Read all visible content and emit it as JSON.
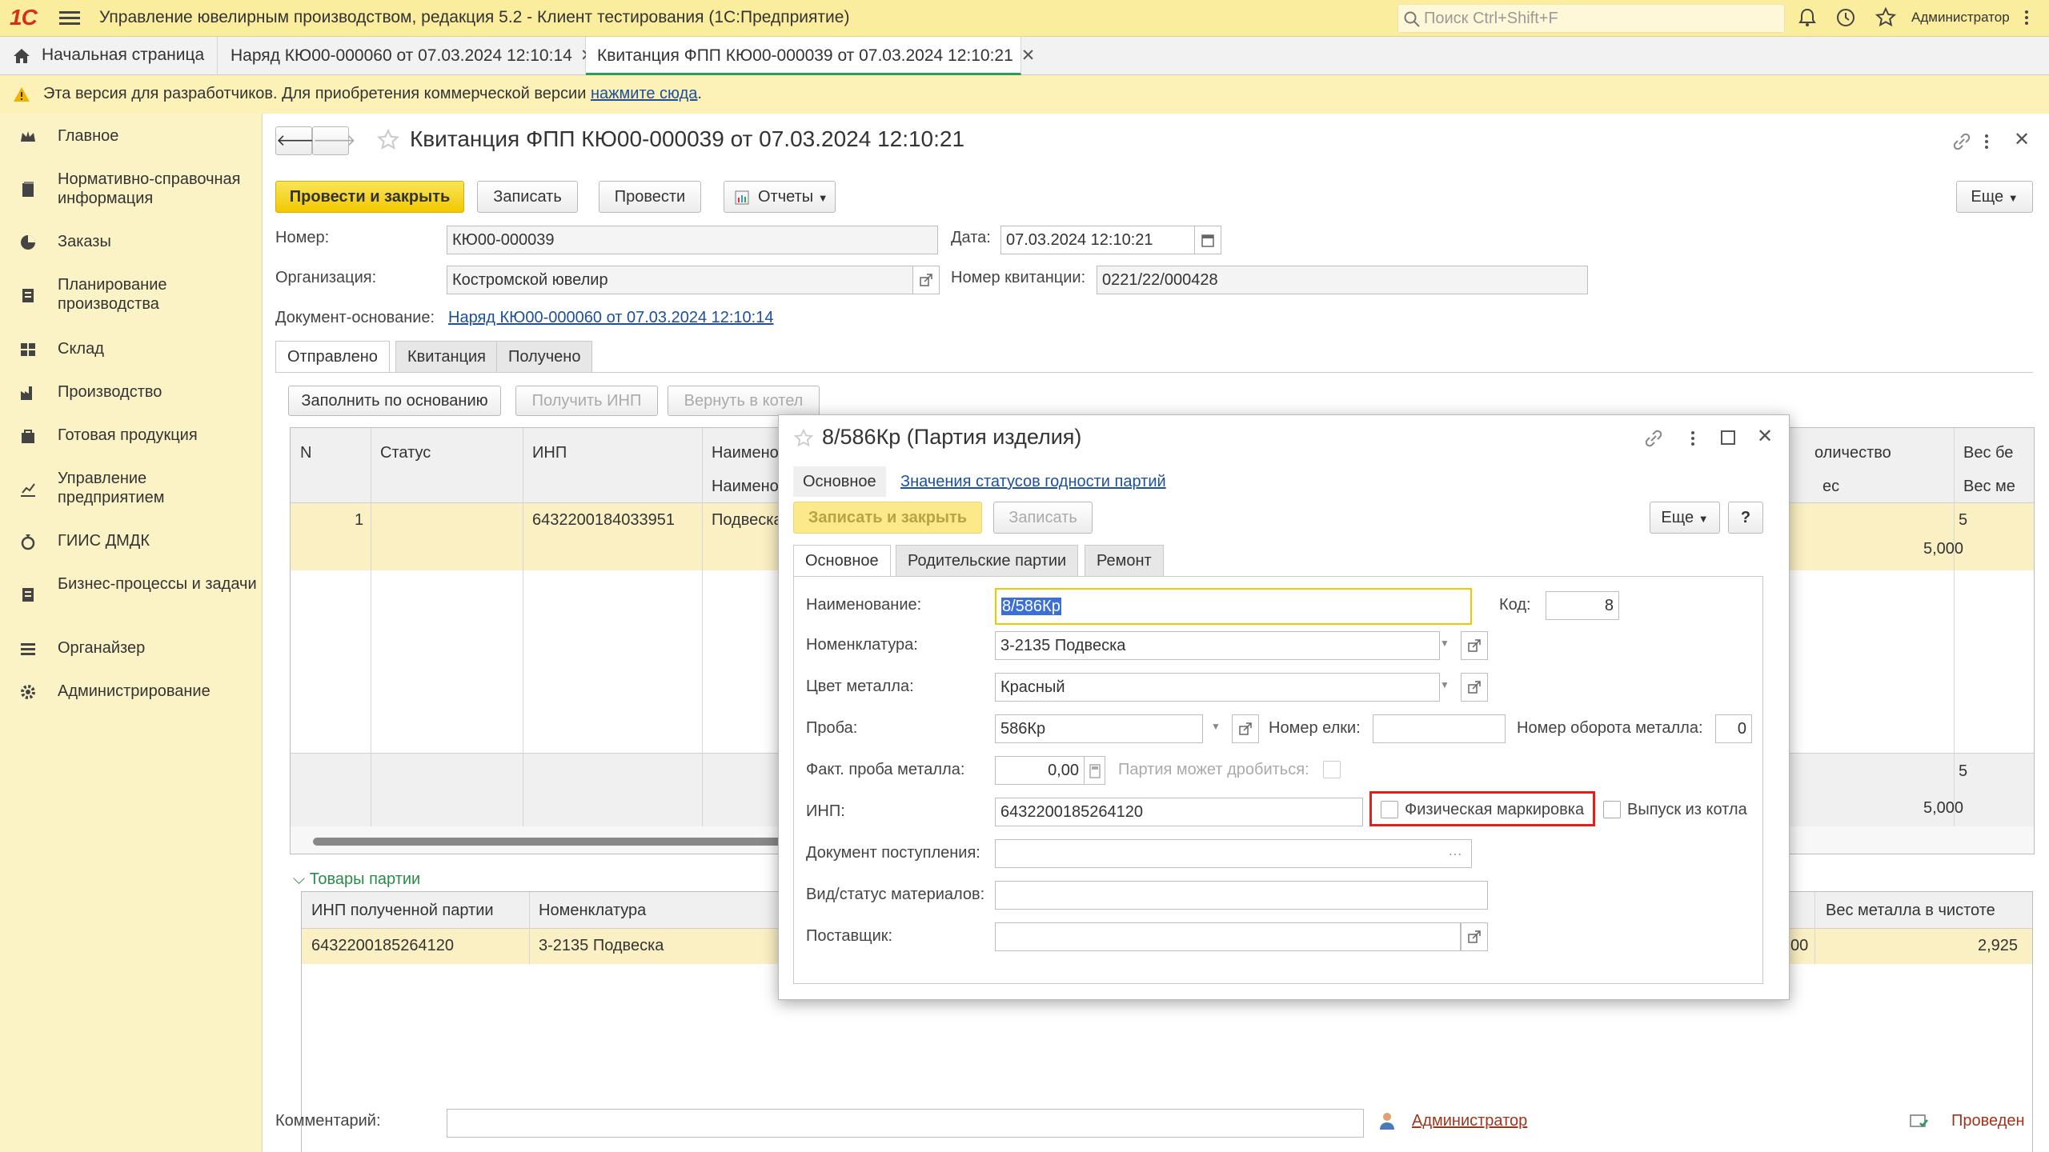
{
  "app": {
    "logo": "1С",
    "title": "Управление ювелирным производством, редакция 5.2  - Клиент тестирования (1С:Предприятие)",
    "search_placeholder": "Поиск Ctrl+Shift+F",
    "user": "Администратор"
  },
  "tabs": [
    {
      "label": "Начальная страница"
    },
    {
      "label": "Наряд КЮ00-000060 от 07.03.2024 12:10:14"
    },
    {
      "label": "Квитанция ФПП КЮ00-000039 от 07.03.2024 12:10:21"
    }
  ],
  "notice": {
    "text": "Эта версия для разработчиков. Для приобретения коммерческой версии ",
    "link": "нажмите сюда",
    "tail": "."
  },
  "sidebar": [
    {
      "label": "Главное",
      "icon": "crown-icon"
    },
    {
      "label": "Нормативно-справочная информация",
      "icon": "book-icon"
    },
    {
      "label": "Заказы",
      "icon": "pie-icon"
    },
    {
      "label": "Планирование производства",
      "icon": "clipboard-icon"
    },
    {
      "label": "Склад",
      "icon": "warehouse-icon"
    },
    {
      "label": "Производство",
      "icon": "factory-icon"
    },
    {
      "label": "Готовая продукция",
      "icon": "bag-icon"
    },
    {
      "label": "Управление предприятием",
      "icon": "chart-icon"
    },
    {
      "label": "ГИИС ДМДК",
      "icon": "ring-icon"
    },
    {
      "label": "Бизнес-процессы и задачи",
      "icon": "tasks-icon"
    },
    {
      "label": "Органайзер",
      "icon": "organizer-icon"
    },
    {
      "label": "Администрирование",
      "icon": "gear-icon"
    }
  ],
  "form": {
    "title": "Квитанция ФПП КЮ00-000039 от 07.03.2024 12:10:21",
    "btn_post_close": "Провести и закрыть",
    "btn_save": "Записать",
    "btn_post": "Провести",
    "btn_reports": "Отчеты",
    "btn_more": "Еще",
    "number_label": "Номер:",
    "number": "КЮ00-000039",
    "date_label": "Дата:",
    "date": "07.03.2024 12:10:21",
    "org_label": "Организация:",
    "org": "Костромской ювелир",
    "receipt_no_label": "Номер квитанции:",
    "receipt_no": "0221/22/000428",
    "base_doc_label": "Документ-основание:",
    "base_doc": "Наряд КЮ00-000060 от 07.03.2024 12:10:14",
    "tabs": [
      "Отправлено",
      "Квитанция",
      "Получено"
    ],
    "btn_fill": "Заполнить по основанию",
    "btn_get_inp": "Получить ИНП",
    "btn_return": "Вернуть в котел",
    "table": {
      "headers": [
        "N",
        "Статус",
        "ИНП",
        "Наимено",
        "Наимено"
      ],
      "right_headers": [
        "оличество",
        "Вес бе",
        "ес",
        "Вес ме"
      ],
      "rows": [
        {
          "n": "1",
          "status": "",
          "inp": "6432200184033951",
          "name": "Подвеска",
          "qty": "5",
          "qty2": "5,000"
        }
      ],
      "totals": [
        "5",
        "5,000"
      ]
    },
    "goods_section": "Товары партии",
    "goods": {
      "headers": [
        "ИНП полученной партии",
        "Номенклатура",
        "Вес металла в чистоте"
      ],
      "rows": [
        {
          "inp": "6432200185264120",
          "nom": "3-2135 Подвеска",
          "partial": "00",
          "weight": "2,925"
        }
      ]
    },
    "comment_label": "Комментарий:",
    "author": "Администратор",
    "status": "Проведен"
  },
  "dialog": {
    "title": "8/586Кр (Партия изделия)",
    "nav_main": "Основное",
    "nav_link": "Значения статусов годности партий",
    "btn_save_close": "Записать и закрыть",
    "btn_save": "Записать",
    "btn_more": "Еще",
    "btn_help": "?",
    "tabs": [
      "Основное",
      "Родительские партии",
      "Ремонт"
    ],
    "name_label": "Наименование:",
    "name": "8/586Кр",
    "code_label": "Код:",
    "code": "8",
    "nom_label": "Номенклатура:",
    "nom": "3-2135 Подвеска",
    "color_label": "Цвет металла:",
    "color": "Красный",
    "probe_label": "Проба:",
    "probe": "586Кр",
    "tree_label": "Номер елки:",
    "tree": "",
    "turn_label": "Номер оборота металла:",
    "turn": "0",
    "fact_label": "Факт. проба металла:",
    "fact": "0,00",
    "split_label": "Партия может дробиться:",
    "inp_label": "ИНП:",
    "inp": "6432200185264120",
    "phys_label": "Физическая маркировка",
    "release_label": "Выпуск из котла",
    "receipt_doc_label": "Документ поступления:",
    "material_label": "Вид/статус материалов:",
    "supplier_label": "Поставщик:"
  },
  "colors": {
    "accent_yellow": "#f1c800",
    "highlight_red": "#e0201b",
    "selection_blue": "#3a6fd8"
  }
}
